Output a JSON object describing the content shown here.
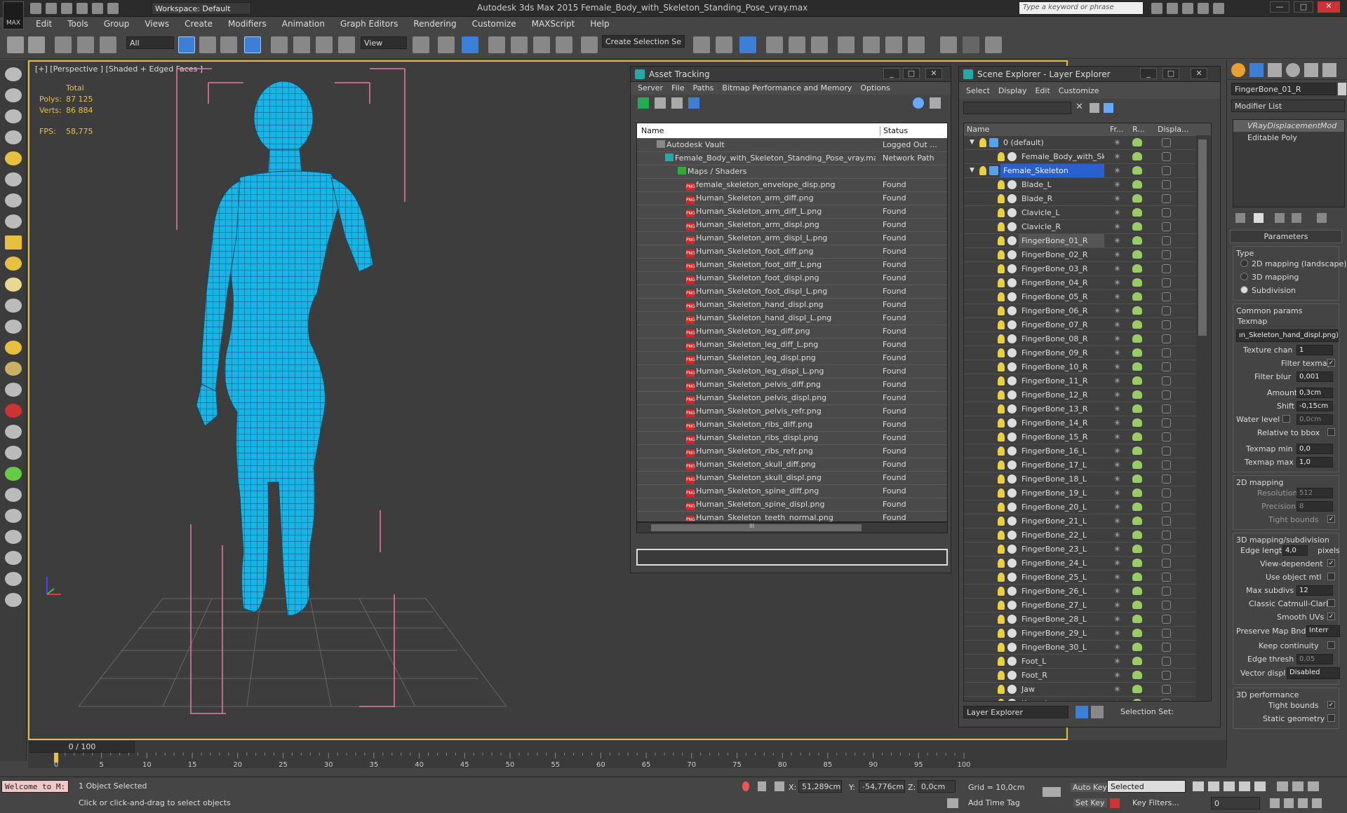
{
  "app": {
    "logo": "MAX",
    "workspace": "Workspace: Default",
    "title": "Autodesk 3ds Max 2015    Female_Body_with_Skeleton_Standing_Pose_vray.max",
    "search_placeholder": "Type a keyword or phrase"
  },
  "menu": [
    "Edit",
    "Tools",
    "Group",
    "Views",
    "Create",
    "Modifiers",
    "Animation",
    "Graph Editors",
    "Rendering",
    "Customize",
    "MAXScript",
    "Help"
  ],
  "toolbar": {
    "filter": "All",
    "refcoord": "View",
    "selection_set": "Create Selection Se"
  },
  "viewport": {
    "label": "[+] [Perspective ] [Shaded + Edged Faces ]",
    "stats_header": "Total",
    "polys_label": "Polys:",
    "polys": "87 125",
    "verts_label": "Verts:",
    "verts": "86 884",
    "fps_label": "FPS:",
    "fps": "58,775"
  },
  "asset_tracking": {
    "title": "Asset Tracking",
    "menu": [
      "Server",
      "File",
      "Paths",
      "Bitmap Performance and Memory",
      "Options"
    ],
    "col_name": "Name",
    "col_status": "Status",
    "vault": {
      "name": "Autodesk Vault",
      "status": "Logged Out ..."
    },
    "file": {
      "name": "Female_Body_with_Skeleton_Standing_Pose_vray.max",
      "status": "Network Path"
    },
    "group": "Maps / Shaders",
    "png_icon": "PNG",
    "maps": [
      {
        "name": "female_skeleton_envelope_disp.png",
        "status": "Found"
      },
      {
        "name": "Human_Skeleton_arm_diff.png",
        "status": "Found"
      },
      {
        "name": "Human_Skeleton_arm_diff_L.png",
        "status": "Found"
      },
      {
        "name": "Human_Skeleton_arm_displ.png",
        "status": "Found"
      },
      {
        "name": "Human_Skeleton_arm_displ_L.png",
        "status": "Found"
      },
      {
        "name": "Human_Skeleton_foot_diff.png",
        "status": "Found"
      },
      {
        "name": "Human_Skeleton_foot_diff_L.png",
        "status": "Found"
      },
      {
        "name": "Human_Skeleton_foot_displ.png",
        "status": "Found"
      },
      {
        "name": "Human_Skeleton_foot_displ_L.png",
        "status": "Found"
      },
      {
        "name": "Human_Skeleton_hand_displ.png",
        "status": "Found"
      },
      {
        "name": "Human_Skeleton_hand_displ_L.png",
        "status": "Found"
      },
      {
        "name": "Human_Skeleton_leg_diff.png",
        "status": "Found"
      },
      {
        "name": "Human_Skeleton_leg_diff_L.png",
        "status": "Found"
      },
      {
        "name": "Human_Skeleton_leg_displ.png",
        "status": "Found"
      },
      {
        "name": "Human_Skeleton_leg_displ_L.png",
        "status": "Found"
      },
      {
        "name": "Human_Skeleton_pelvis_diff.png",
        "status": "Found"
      },
      {
        "name": "Human_Skeleton_pelvis_displ.png",
        "status": "Found"
      },
      {
        "name": "Human_Skeleton_pelvis_refr.png",
        "status": "Found"
      },
      {
        "name": "Human_Skeleton_ribs_diff.png",
        "status": "Found"
      },
      {
        "name": "Human_Skeleton_ribs_displ.png",
        "status": "Found"
      },
      {
        "name": "Human_Skeleton_ribs_refr.png",
        "status": "Found"
      },
      {
        "name": "Human_Skeleton_skull_diff.png",
        "status": "Found"
      },
      {
        "name": "Human_Skeleton_skull_displ.png",
        "status": "Found"
      },
      {
        "name": "Human_Skeleton_spine_diff.png",
        "status": "Found"
      },
      {
        "name": "Human_Skeleton_spine_displ.png",
        "status": "Found"
      },
      {
        "name": "Human_Skeleton_teeth_normal.png",
        "status": "Found"
      }
    ],
    "hscroll_label": "III"
  },
  "scene_explorer": {
    "title": "Scene Explorer - Layer Explorer",
    "menu": [
      "Select",
      "Display",
      "Edit",
      "Customize"
    ],
    "cols": [
      "Name",
      "Fr...",
      "R...",
      "Displa..."
    ],
    "layers": [
      {
        "name": "0 (default)",
        "level": 0,
        "type": "layer",
        "selected": false
      },
      {
        "name": "Female_Body_with_Skel...",
        "level": 1,
        "type": "obj",
        "selected": false
      },
      {
        "name": "Female_Skeleton",
        "level": 0,
        "type": "layer",
        "selected": true
      },
      {
        "name": "Blade_L",
        "level": 1,
        "type": "obj",
        "selected": false
      },
      {
        "name": "Blade_R",
        "level": 1,
        "type": "obj",
        "selected": false
      },
      {
        "name": "Clavicle_L",
        "level": 1,
        "type": "obj",
        "selected": false
      },
      {
        "name": "Clavicle_R",
        "level": 1,
        "type": "obj",
        "selected": false
      },
      {
        "name": "FingerBone_01_R",
        "level": 1,
        "type": "obj",
        "selected": false,
        "hl": true
      },
      {
        "name": "FingerBone_02_R",
        "level": 1,
        "type": "obj",
        "selected": false
      },
      {
        "name": "FingerBone_03_R",
        "level": 1,
        "type": "obj",
        "selected": false
      },
      {
        "name": "FingerBone_04_R",
        "level": 1,
        "type": "obj",
        "selected": false
      },
      {
        "name": "FingerBone_05_R",
        "level": 1,
        "type": "obj",
        "selected": false
      },
      {
        "name": "FingerBone_06_R",
        "level": 1,
        "type": "obj",
        "selected": false
      },
      {
        "name": "FingerBone_07_R",
        "level": 1,
        "type": "obj",
        "selected": false
      },
      {
        "name": "FingerBone_08_R",
        "level": 1,
        "type": "obj",
        "selected": false
      },
      {
        "name": "FingerBone_09_R",
        "level": 1,
        "type": "obj",
        "selected": false
      },
      {
        "name": "FingerBone_10_R",
        "level": 1,
        "type": "obj",
        "selected": false
      },
      {
        "name": "FingerBone_11_R",
        "level": 1,
        "type": "obj",
        "selected": false
      },
      {
        "name": "FingerBone_12_R",
        "level": 1,
        "type": "obj",
        "selected": false
      },
      {
        "name": "FingerBone_13_R",
        "level": 1,
        "type": "obj",
        "selected": false
      },
      {
        "name": "FingerBone_14_R",
        "level": 1,
        "type": "obj",
        "selected": false
      },
      {
        "name": "FingerBone_15_R",
        "level": 1,
        "type": "obj",
        "selected": false
      },
      {
        "name": "FingerBone_16_L",
        "level": 1,
        "type": "obj",
        "selected": false
      },
      {
        "name": "FingerBone_17_L",
        "level": 1,
        "type": "obj",
        "selected": false
      },
      {
        "name": "FingerBone_18_L",
        "level": 1,
        "type": "obj",
        "selected": false
      },
      {
        "name": "FingerBone_19_L",
        "level": 1,
        "type": "obj",
        "selected": false
      },
      {
        "name": "FingerBone_20_L",
        "level": 1,
        "type": "obj",
        "selected": false
      },
      {
        "name": "FingerBone_21_L",
        "level": 1,
        "type": "obj",
        "selected": false
      },
      {
        "name": "FingerBone_22_L",
        "level": 1,
        "type": "obj",
        "selected": false
      },
      {
        "name": "FingerBone_23_L",
        "level": 1,
        "type": "obj",
        "selected": false
      },
      {
        "name": "FingerBone_24_L",
        "level": 1,
        "type": "obj",
        "selected": false
      },
      {
        "name": "FingerBone_25_L",
        "level": 1,
        "type": "obj",
        "selected": false
      },
      {
        "name": "FingerBone_26_L",
        "level": 1,
        "type": "obj",
        "selected": false
      },
      {
        "name": "FingerBone_27_L",
        "level": 1,
        "type": "obj",
        "selected": false
      },
      {
        "name": "FingerBone_28_L",
        "level": 1,
        "type": "obj",
        "selected": false
      },
      {
        "name": "FingerBone_29_L",
        "level": 1,
        "type": "obj",
        "selected": false
      },
      {
        "name": "FingerBone_30_L",
        "level": 1,
        "type": "obj",
        "selected": false
      },
      {
        "name": "Foot_L",
        "level": 1,
        "type": "obj",
        "selected": false
      },
      {
        "name": "Foot_R",
        "level": 1,
        "type": "obj",
        "selected": false
      },
      {
        "name": "Jaw",
        "level": 1,
        "type": "obj",
        "selected": false
      },
      {
        "name": "Knee_L",
        "level": 1,
        "type": "obj",
        "selected": false
      }
    ],
    "footer_mode": "Layer Explorer",
    "footer_selset": "Selection Set:"
  },
  "command_panel": {
    "object_name": "FingerBone_01_R",
    "modifier_list": "Modifier List",
    "stack": [
      "VRayDisplacementMod",
      "Editable Poly"
    ],
    "rollout": "Parameters",
    "type_label": "Type",
    "type_opts": [
      "2D mapping (landscape)",
      "3D mapping",
      "Subdivision"
    ],
    "type_selected": 2,
    "common": "Common params",
    "texmap_label": "Texmap",
    "texmap": "ın_Skeleton_hand_displ.png)",
    "texture_chan_label": "Texture chan",
    "texture_chan": "1",
    "filter_texmap_label": "Filter texmap",
    "filter_blur_label": "Filter blur",
    "filter_blur": "0,001",
    "amount_label": "Amount",
    "amount": "0,3cm",
    "shift_label": "Shift",
    "shift": "-0,15cm",
    "water_label": "Water level",
    "water": "0,0cm",
    "relbbox_label": "Relative to bbox",
    "tmin_label": "Texmap min",
    "tmin": "0,0",
    "tmax_label": "Texmap max",
    "tmax": "1,0",
    "g2d": "2D mapping",
    "res_label": "Resolution",
    "res": "512",
    "prec_label": "Precision",
    "prec": "8",
    "tight_label": "Tight bounds",
    "g3d": "3D mapping/subdivision",
    "edge_label": "Edge length",
    "edge": "4,0",
    "pixels": "pixels",
    "viewdep": "View-dependent",
    "useobj": "Use object mtl",
    "maxsub_label": "Max subdivs",
    "maxsub": "12",
    "catmull": "Classic Catmull-Clark",
    "smoothuv": "Smooth UVs",
    "preserve_label": "Preserve Map Bnd",
    "preserve": "Interr",
    "keepcont": "Keep continuity",
    "ethresh_label": "Edge thresh",
    "ethresh": "0,05",
    "vdispl_label": "Vector displ",
    "vdispl": "Disabled",
    "g3dperf": "3D performance",
    "tight2": "Tight bounds",
    "static": "Static geometry"
  },
  "timeline": {
    "frame": "0 / 100",
    "ticks": [
      "0",
      "5",
      "10",
      "15",
      "20",
      "25",
      "30",
      "35",
      "40",
      "45",
      "50",
      "55",
      "60",
      "65",
      "70",
      "75",
      "80",
      "85",
      "90",
      "95",
      "100"
    ]
  },
  "status": {
    "maxscript": "Welcome to M:",
    "objects": "1 Object Selected",
    "prompt": "Click or click-and-drag to select objects",
    "x_label": "X:",
    "x": "51,289cm",
    "y_label": "Y:",
    "y": "-54,776cm",
    "z_label": "Z:",
    "z": "0,0cm",
    "grid": "Grid = 10,0cm",
    "autokey": "Auto Key",
    "selected": "Selected",
    "setkey": "Set Key",
    "keyfilters": "Key Filters...",
    "addtimetag": "Add Time Tag",
    "frame_field": "0"
  },
  "colors": {
    "mesh": "#19b4e6",
    "wire": "#0a4a63",
    "bbox": "#e87aa8",
    "active_border": "#e8c040",
    "selection": "#2a5fd0"
  }
}
